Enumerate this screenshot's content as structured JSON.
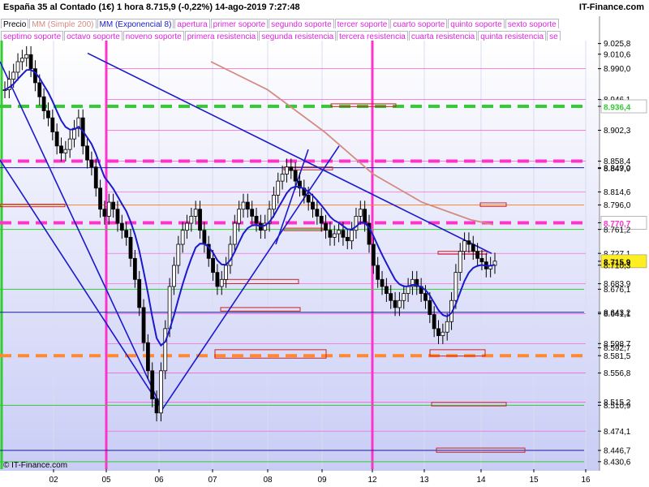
{
  "header": {
    "title": "España 35 al Contado (1€)   1 hora   8.715,9 (-0,22%)   14-ago-2019 7:27:48",
    "brand": "IT-Finance.com"
  },
  "legend": {
    "row1": [
      {
        "label": "Precio",
        "color": "#000000"
      },
      {
        "label": "MM (Simple 200)",
        "color": "#d48a7e"
      },
      {
        "label": "MM (Exponencial 8)",
        "color": "#1a1acc"
      },
      {
        "label": "apertura",
        "color": "#dd22dd"
      },
      {
        "label": "primer soporte",
        "color": "#dd22dd"
      },
      {
        "label": "segundo soporte",
        "color": "#dd22dd"
      },
      {
        "label": "tercer soporte",
        "color": "#dd22dd"
      },
      {
        "label": "cuarto soporte",
        "color": "#dd22dd"
      },
      {
        "label": "quinto soporte",
        "color": "#dd22dd"
      },
      {
        "label": "sexto soporte",
        "color": "#dd22dd"
      }
    ],
    "row2": [
      {
        "label": "septimo soporte",
        "color": "#dd22dd"
      },
      {
        "label": "octavo soporte",
        "color": "#dd22dd"
      },
      {
        "label": "noveno soporte",
        "color": "#dd22dd"
      },
      {
        "label": "primera resistencia",
        "color": "#dd22dd"
      },
      {
        "label": "segunda resistencia",
        "color": "#dd22dd"
      },
      {
        "label": "tercera resistencia",
        "color": "#dd22dd"
      },
      {
        "label": "cuarta resistencia",
        "color": "#dd22dd"
      },
      {
        "label": "quinta resistencia",
        "color": "#dd22dd"
      },
      {
        "label": "se",
        "color": "#dd22dd"
      }
    ]
  },
  "copyright": "© IT-Finance.com",
  "colors": {
    "bg_top": "#ffffff",
    "bg_bottom": "#c9cdf5",
    "green": "#33cc33",
    "magenta": "#ff33cc",
    "orange": "#ff8833",
    "navy": "#1a1a9a",
    "red": "#cc2222",
    "ma200": "#d48a7e",
    "ema8": "#1a1acc"
  },
  "chart_data": {
    "type": "candlestick",
    "title": "España 35 al Contado (1€)",
    "x_ticks": [
      "02",
      "05",
      "06",
      "07",
      "08",
      "09",
      "12",
      "13",
      "14",
      "15",
      "16"
    ],
    "y_range": [
      8420,
      9030
    ],
    "y_labels": [
      {
        "text": "9.025,8",
        "value": 9025.8
      },
      {
        "text": "9.010,6",
        "value": 9010.6
      },
      {
        "text": "8.990,0",
        "value": 8990.0
      },
      {
        "text": "8.946,1",
        "value": 8946.1
      },
      {
        "text": "8.936,4",
        "value": 8936.4,
        "highlight": "green"
      },
      {
        "text": "8.902,3",
        "value": 8902.3
      },
      {
        "text": "8.858,4",
        "value": 8858.4
      },
      {
        "text": "8.849,0",
        "value": 8849.0
      },
      {
        "text": "8.847,9",
        "value": 8847.9
      },
      {
        "text": "8.814,6",
        "value": 8814.6
      },
      {
        "text": "8.796,0",
        "value": 8796.0
      },
      {
        "text": "8.770,7",
        "value": 8770.7,
        "highlight": "magenta"
      },
      {
        "text": "8.761,2",
        "value": 8761.2
      },
      {
        "text": "8.727,1",
        "value": 8727.1
      },
      {
        "text": "8.715,9",
        "value": 8715.9,
        "highlight": "yellow"
      },
      {
        "text": "8.710,3",
        "value": 8710.3
      },
      {
        "text": "8.683,9",
        "value": 8683.9
      },
      {
        "text": "8.676,1",
        "value": 8676.1
      },
      {
        "text": "8.643,2",
        "value": 8643.2
      },
      {
        "text": "8.641,1",
        "value": 8641.1
      },
      {
        "text": "8.598,7",
        "value": 8598.7
      },
      {
        "text": "8.592,7",
        "value": 8592.7
      },
      {
        "text": "8.581,5",
        "value": 8581.5
      },
      {
        "text": "8.556,8",
        "value": 8556.8
      },
      {
        "text": "8.515,2",
        "value": 8515.2
      },
      {
        "text": "8.510,9",
        "value": 8510.9
      },
      {
        "text": "8.474,1",
        "value": 8474.1
      },
      {
        "text": "8.446,7",
        "value": 8446.7
      },
      {
        "text": "8.430,6",
        "value": 8430.6
      }
    ],
    "last_price": 8715.9,
    "change_pct": -0.22,
    "levels": [
      {
        "value": 8936.4,
        "color": "#33cc33",
        "style": "dashed"
      },
      {
        "value": 8849.0,
        "color": "#1a1a9a",
        "style": "solid"
      },
      {
        "value": 8858.4,
        "color": "#ff33cc",
        "style": "dashed"
      },
      {
        "value": 8770.7,
        "color": "#ff33cc",
        "style": "dashed"
      },
      {
        "value": 8796.0,
        "color": "#ff8833",
        "style": "solid"
      },
      {
        "value": 8581.5,
        "color": "#ff8833",
        "style": "dashed"
      },
      {
        "value": 8643.2,
        "color": "#1a1a9a",
        "style": "solid"
      },
      {
        "value": 8446.7,
        "color": "#1a1a9a",
        "style": "solid"
      },
      {
        "value": 8676.1,
        "color": "#33cc33",
        "style": "solid"
      },
      {
        "value": 8761.2,
        "color": "#33cc33",
        "style": "solid"
      },
      {
        "value": 8510.9,
        "color": "#33cc33",
        "style": "solid"
      },
      {
        "value": 8430.6,
        "color": "#33cc33",
        "style": "solid"
      }
    ],
    "close_series": [
      8960,
      8975,
      8985,
      9000,
      9005,
      9010,
      8990,
      8970,
      8950,
      8930,
      8920,
      8900,
      8880,
      8870,
      8875,
      8890,
      8905,
      8920,
      8880,
      8860,
      8850,
      8820,
      8790,
      8780,
      8800,
      8790,
      8770,
      8760,
      8750,
      8720,
      8690,
      8650,
      8600,
      8560,
      8520,
      8500,
      8560,
      8620,
      8680,
      8710,
      8740,
      8760,
      8770,
      8780,
      8790,
      8760,
      8740,
      8720,
      8700,
      8680,
      8690,
      8710,
      8740,
      8770,
      8790,
      8800,
      8790,
      8780,
      8770,
      8760,
      8770,
      8790,
      8810,
      8830,
      8840,
      8850,
      8845,
      8830,
      8820,
      8810,
      8800,
      8790,
      8780,
      8770,
      8760,
      8750,
      8755,
      8760,
      8750,
      8745,
      8760,
      8780,
      8790,
      8770,
      8740,
      8710,
      8690,
      8680,
      8670,
      8660,
      8650,
      8660,
      8670,
      8680,
      8690,
      8680,
      8670,
      8660,
      8640,
      8620,
      8610,
      8615,
      8630,
      8660,
      8700,
      8730,
      8745,
      8740,
      8730,
      8720,
      8715,
      8705,
      8710,
      8716
    ]
  }
}
